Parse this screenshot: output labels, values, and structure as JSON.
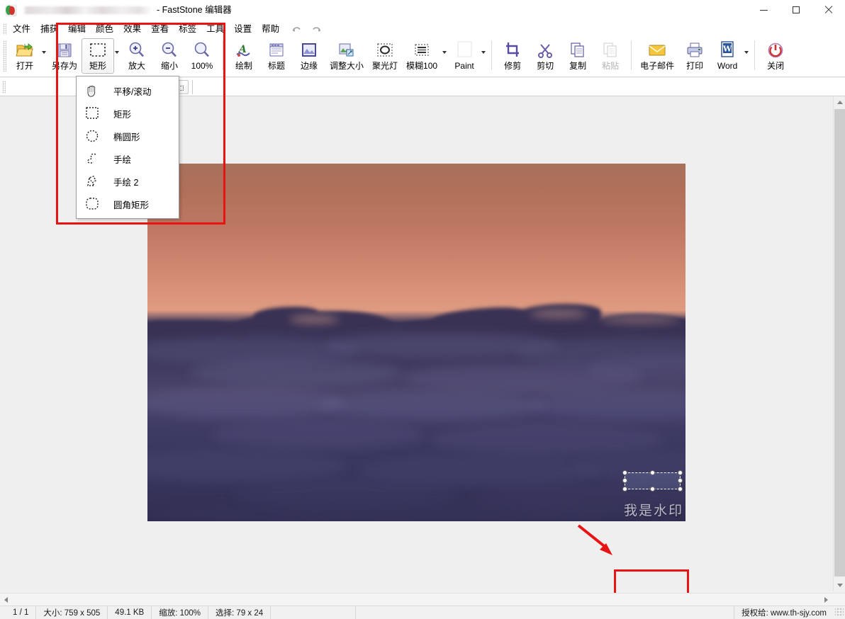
{
  "window": {
    "title_suffix": "- FastStone 编辑器",
    "app_icon": "faststone-logo-icon",
    "controls": {
      "minimize": "minimize-icon",
      "maximize": "maximize-icon",
      "close": "close-icon"
    }
  },
  "menubar": {
    "items": [
      {
        "label": "文件"
      },
      {
        "label": "捕获"
      },
      {
        "label": "编辑"
      },
      {
        "label": "颜色"
      },
      {
        "label": "效果"
      },
      {
        "label": "查看"
      },
      {
        "label": "标签"
      },
      {
        "label": "工具"
      },
      {
        "label": "设置"
      },
      {
        "label": "帮助"
      }
    ],
    "undo": "undo-icon",
    "redo": "redo-icon"
  },
  "toolbar": {
    "buttons": [
      {
        "label": "打开",
        "icon": "open-folder-icon",
        "caret": true,
        "active": false,
        "disabled": false
      },
      {
        "label": "另存为",
        "icon": "save-as-icon",
        "caret": false,
        "active": false,
        "disabled": false
      },
      {
        "label": "矩形",
        "icon": "rectangle-select-icon",
        "caret": true,
        "active": true,
        "disabled": false
      },
      {
        "label": "放大",
        "icon": "zoom-in-icon",
        "caret": false,
        "active": false,
        "disabled": false
      },
      {
        "label": "缩小",
        "icon": "zoom-out-icon",
        "caret": false,
        "active": false,
        "disabled": false
      },
      {
        "label": "100%",
        "icon": "zoom-actual-icon",
        "caret": false,
        "active": false,
        "disabled": false
      },
      {
        "label": "绘制",
        "icon": "draw-icon",
        "caret": false,
        "active": false,
        "disabled": false
      },
      {
        "label": "标题",
        "icon": "caption-icon",
        "caret": false,
        "active": false,
        "disabled": false
      },
      {
        "label": "边缘",
        "icon": "edge-icon",
        "caret": false,
        "active": false,
        "disabled": false
      },
      {
        "label": "调整大小",
        "icon": "resize-icon",
        "caret": false,
        "active": false,
        "disabled": false
      },
      {
        "label": "聚光灯",
        "icon": "spotlight-icon",
        "caret": false,
        "active": false,
        "disabled": false
      },
      {
        "label": "模糊100",
        "icon": "blur-icon",
        "caret": true,
        "active": false,
        "disabled": false
      },
      {
        "label": "Paint",
        "icon": "paint-swatch-icon",
        "caret": true,
        "active": false,
        "disabled": false
      },
      {
        "label": "修剪",
        "icon": "crop-icon",
        "caret": false,
        "active": false,
        "disabled": false
      },
      {
        "label": "剪切",
        "icon": "cut-scissors-icon",
        "caret": false,
        "active": false,
        "disabled": false
      },
      {
        "label": "复制",
        "icon": "copy-icon",
        "caret": false,
        "active": false,
        "disabled": false
      },
      {
        "label": "粘贴",
        "icon": "paste-icon",
        "caret": false,
        "active": false,
        "disabled": true
      },
      {
        "label": "电子邮件",
        "icon": "email-envelope-icon",
        "caret": false,
        "active": false,
        "disabled": false
      },
      {
        "label": "打印",
        "icon": "printer-icon",
        "caret": false,
        "active": false,
        "disabled": false
      },
      {
        "label": "Word",
        "icon": "word-icon",
        "caret": true,
        "active": false,
        "disabled": false
      },
      {
        "label": "关闭",
        "icon": "power-close-icon",
        "caret": false,
        "active": false,
        "disabled": false
      }
    ]
  },
  "dropdown": {
    "open": true,
    "owner": "矩形",
    "items": [
      {
        "label": "平移/滚动",
        "icon": "hand-pan-icon"
      },
      {
        "label": "矩形",
        "icon": "rect-marquee-icon"
      },
      {
        "label": "椭圆形",
        "icon": "ellipse-marquee-icon"
      },
      {
        "label": "手绘",
        "icon": "freehand-icon"
      },
      {
        "label": "手绘 2",
        "icon": "freehand2-icon"
      },
      {
        "label": "圆角矩形",
        "icon": "rounded-rect-marquee-icon"
      }
    ]
  },
  "canvas": {
    "image_alt": "sunset-above-clouds-photo",
    "watermark_text": "我是水印",
    "selection": {
      "width": 79,
      "height": 24
    }
  },
  "annotations": {
    "toolbar_highlight": "red-rectangle-toolbar",
    "selection_highlight": "red-rectangle-selection",
    "arrow": "red-arrow-pointer"
  },
  "statusbar": {
    "page": "1 / 1",
    "size": "大小: 759 x 505",
    "filesize": "49.1 KB",
    "zoom": "缩放: 100%",
    "selection": "选择: 79 x 24",
    "license": "授权给: www.th-sjy.com"
  },
  "colors": {
    "accent_red": "#e81414",
    "toolbar_bg": "#ffffff",
    "canvas_bg": "#efefef",
    "statusbar_bg": "#f0f0f0"
  }
}
